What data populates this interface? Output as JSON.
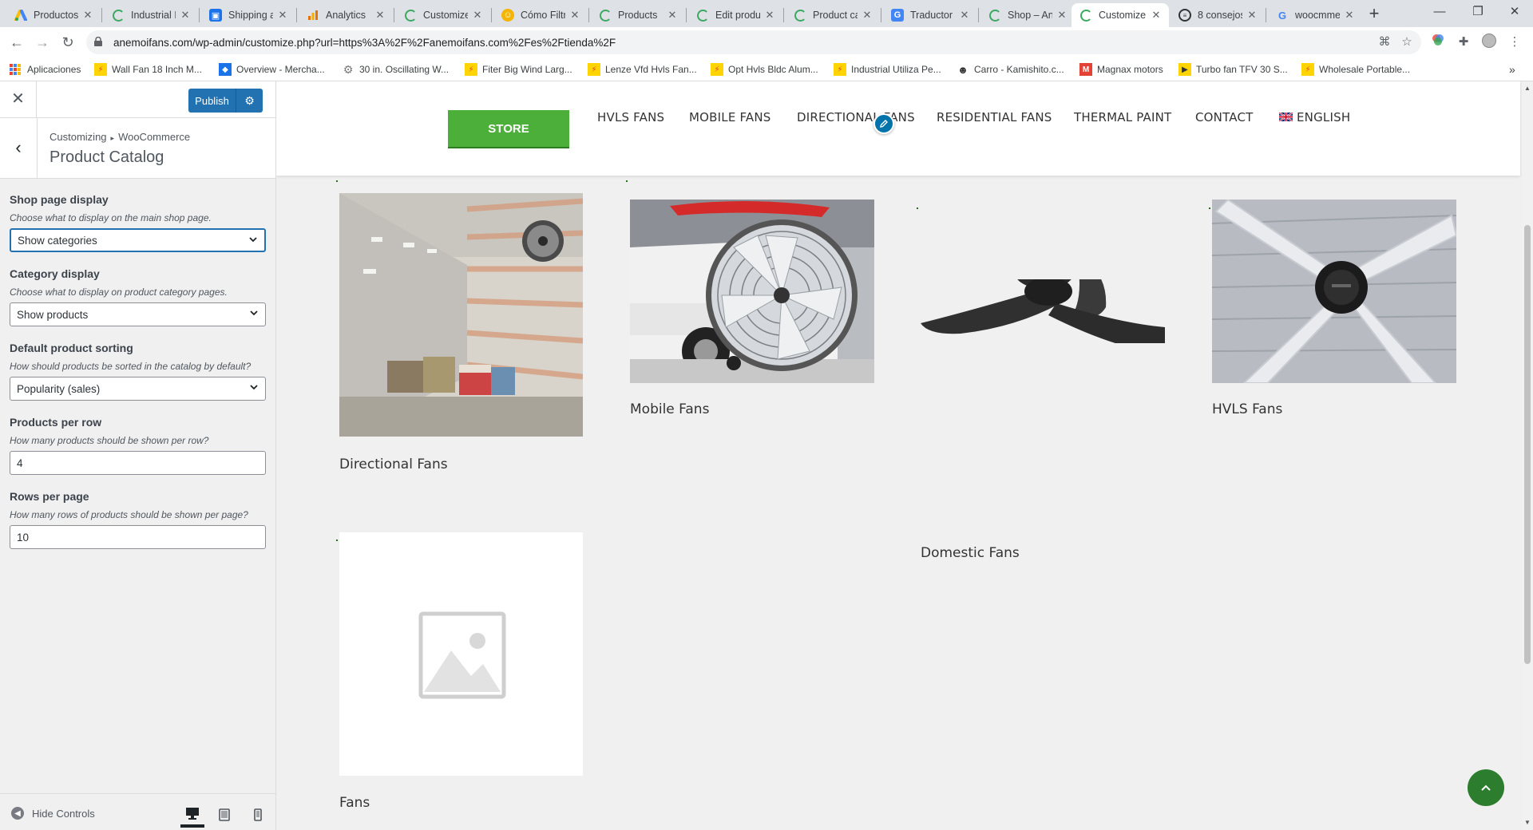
{
  "browser": {
    "tabs": [
      {
        "label": "Productos",
        "icon": "google-ads-icon",
        "active": false
      },
      {
        "label": "Industrial I",
        "icon": "wordpress-icon",
        "active": false
      },
      {
        "label": "Shipping a",
        "icon": "shipping-icon",
        "active": false
      },
      {
        "label": "Analytics",
        "icon": "analytics-icon",
        "active": false
      },
      {
        "label": "Customize",
        "icon": "wordpress-icon",
        "active": false
      },
      {
        "label": "Cómo Filtr",
        "icon": "smiley-icon",
        "active": false
      },
      {
        "label": "Products",
        "icon": "wordpress-icon",
        "active": false
      },
      {
        "label": "Edit produ",
        "icon": "wordpress-icon",
        "active": false
      },
      {
        "label": "Product ca",
        "icon": "wordpress-icon",
        "active": false
      },
      {
        "label": "Traductor",
        "icon": "translate-icon",
        "active": false
      },
      {
        "label": "Shop – An",
        "icon": "wordpress-icon",
        "active": false
      },
      {
        "label": "Customize",
        "icon": "wordpress-icon",
        "active": true
      },
      {
        "label": "8 consejos",
        "icon": "article-icon",
        "active": false
      },
      {
        "label": "woocmme",
        "icon": "google-icon",
        "active": false
      }
    ],
    "url": "anemoifans.com/wp-admin/customize.php?url=https%3A%2F%2Fanemoifans.com%2Fes%2Ftienda%2F",
    "bookmarks": [
      {
        "label": "Aplicaciones",
        "icon": "apps-icon"
      },
      {
        "label": "Wall Fan 18 Inch M...",
        "icon": "alibaba-icon"
      },
      {
        "label": "Overview - Mercha...",
        "icon": "merchant-icon"
      },
      {
        "label": "30 in. Oscillating W...",
        "icon": "gear-icon"
      },
      {
        "label": "Fiter Big Wind Larg...",
        "icon": "alibaba-icon"
      },
      {
        "label": "Lenze Vfd Hvls Fan...",
        "icon": "alibaba-icon"
      },
      {
        "label": "Opt Hvls Bldc Alum...",
        "icon": "alibaba-icon"
      },
      {
        "label": "Industrial Utiliza Pe...",
        "icon": "alibaba-icon"
      },
      {
        "label": "Carro - Kamishito.c...",
        "icon": "person-icon"
      },
      {
        "label": "Magnax motors",
        "icon": "magnax-icon"
      },
      {
        "label": "Turbo fan TFV 30 S...",
        "icon": "play-icon"
      },
      {
        "label": "Wholesale Portable...",
        "icon": "alibaba-icon"
      }
    ]
  },
  "customizer": {
    "publish_label": "Publish",
    "breadcrumb": {
      "root": "Customizing",
      "parent": "WooCommerce"
    },
    "section_title": "Product Catalog",
    "controls": [
      {
        "label": "Shop page display",
        "description": "Choose what to display on the main shop page.",
        "value": "Show categories",
        "type": "select"
      },
      {
        "label": "Category display",
        "description": "Choose what to display on product category pages.",
        "value": "Show products",
        "type": "select"
      },
      {
        "label": "Default product sorting",
        "description": "How should products be sorted in the catalog by default?",
        "value": "Popularity (sales)",
        "type": "select"
      },
      {
        "label": "Products per row",
        "description": "How many products should be shown per row?",
        "value": "4",
        "type": "number"
      },
      {
        "label": "Rows per page",
        "description": "How many rows of products should be shown per page?",
        "value": "10",
        "type": "number"
      }
    ],
    "hide_controls_label": "Hide Controls"
  },
  "site": {
    "store_label": "STORE",
    "nav": [
      "HVLS FANS",
      "MOBILE FANS",
      "DIRECTIONAL FANS",
      "RESIDENTIAL FANS",
      "THERMAL PAINT",
      "CONTACT",
      "ENGLISH"
    ],
    "categories": [
      {
        "title": "Directional Fans",
        "image": "warehouse-wall-fan-photo"
      },
      {
        "title": "Mobile Fans",
        "image": "drum-fan-photo"
      },
      {
        "title": "Domestic Fans",
        "image": "ceiling-fan-photo"
      },
      {
        "title": "HVLS Fans",
        "image": "hvls-fan-photo"
      },
      {
        "title": "Fans",
        "image": "placeholder-image"
      }
    ]
  },
  "colors": {
    "accent_green": "#4caf3a",
    "wp_blue": "#2271b1",
    "scroll_top_green": "#2d7d2f"
  }
}
